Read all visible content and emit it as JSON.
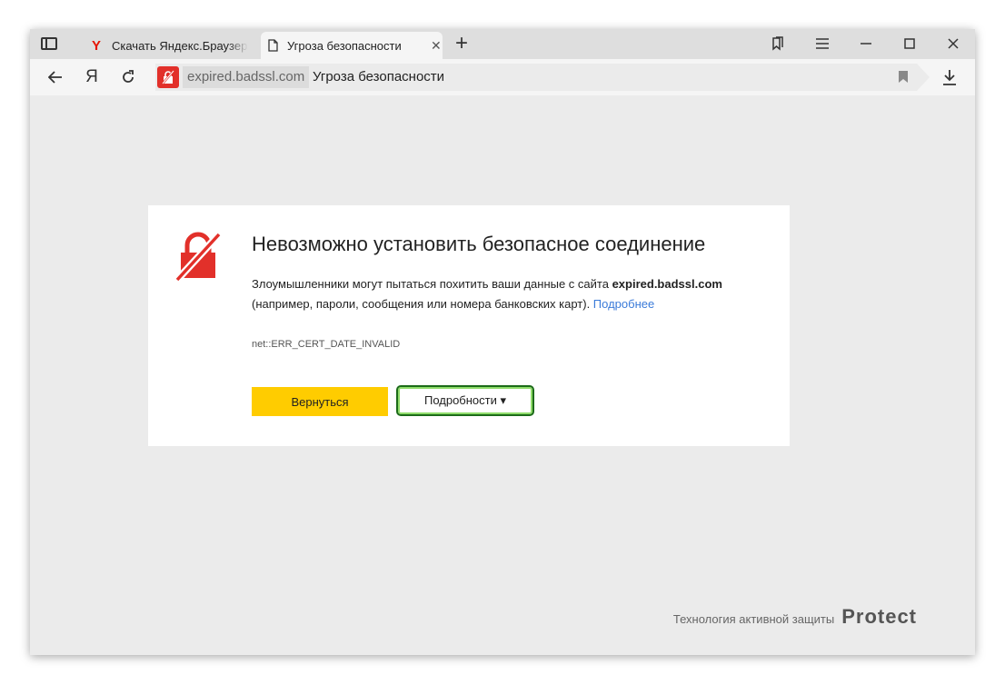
{
  "tabs": [
    {
      "title": "Скачать Яндекс.Браузер д",
      "icon": "yandex-logo-icon",
      "active": false
    },
    {
      "title": "Угроза безопасности",
      "icon": "document-icon",
      "active": true
    }
  ],
  "tabbar": {
    "yandex_letter": "Y",
    "close_glyph": "✕",
    "newtab_glyph": "+"
  },
  "address": {
    "domain": "expired.badssl.com",
    "page_title": "Угроза безопасности",
    "yandex_letter": "Я"
  },
  "error": {
    "title": "Невозможно установить безопасное соединение",
    "desc_prefix": "Злоумышленники могут пытаться похитить ваши данные с сайта ",
    "desc_domain": "expired.badssl.com",
    "desc_suffix": " (например, пароли, сообщения или номера банковских карт). ",
    "more_link": "Подробнее",
    "code": "net::ERR_CERT_DATE_INVALID",
    "back_label": "Вернуться",
    "details_label": "Подробности ▾"
  },
  "footer": {
    "tech_text": "Технология активной защиты",
    "brand": "Protect"
  },
  "colors": {
    "danger": "#e2302a",
    "accent_button": "#ffcc00",
    "link": "#3b7bd9",
    "focus_ring": "#1c6b19"
  }
}
